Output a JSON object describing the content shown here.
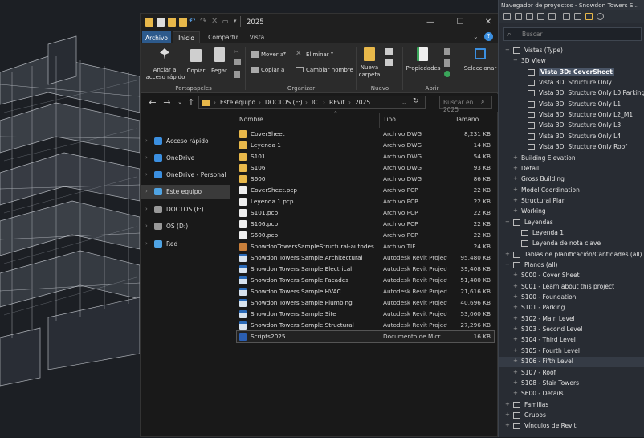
{
  "window": {
    "title": "2025",
    "minimize": "—",
    "maximize": "☐",
    "close": "✕"
  },
  "tabs": [
    "Archivo",
    "Inicio",
    "Compartir",
    "Vista"
  ],
  "ribbon": {
    "anclar": "Anclar al acceso rápido",
    "copiar": "Copiar",
    "pegar": "Pegar",
    "portapapeles": "Portapapeles",
    "mover": "Mover a",
    "copiar_a": "Copiar a",
    "eliminar": "Eliminar",
    "cambiar": "Cambiar nombre",
    "organizar": "Organizar",
    "nueva": "Nueva carpeta",
    "nuevo": "Nuevo",
    "propiedades": "Propiedades",
    "abrir": "Abrir",
    "seleccionar": "Seleccionar"
  },
  "address": {
    "crumbs": [
      "Este equipo",
      "DOCTOS (F:)",
      "IC",
      "REvit",
      "2025"
    ],
    "search_placeholder": "Buscar en 2025"
  },
  "nav": [
    {
      "label": "Acceso rápido",
      "icon": "star-icon",
      "color": "#3b8fe0"
    },
    {
      "label": "OneDrive",
      "icon": "cloud-icon",
      "color": "#3b8fe0"
    },
    {
      "label": "OneDrive - Personal",
      "icon": "cloud-icon",
      "color": "#3b8fe0"
    },
    {
      "label": "Este equipo",
      "icon": "pc-icon",
      "color": "#4fa3e3"
    },
    {
      "label": "DOCTOS (F:)",
      "icon": "drive-icon",
      "color": "#999999"
    },
    {
      "label": "OS (D:)",
      "icon": "drive-icon",
      "color": "#999999"
    },
    {
      "label": "Red",
      "icon": "network-icon",
      "color": "#4fa3e3"
    }
  ],
  "columns": {
    "name": "Nombre",
    "type": "Tipo",
    "size": "Tamaño"
  },
  "files": [
    {
      "name": "CoverSheet",
      "type": "Archivo DWG",
      "size": "8,231 KB",
      "icon": "folder-yellow"
    },
    {
      "name": "Leyenda 1",
      "type": "Archivo DWG",
      "size": "14 KB",
      "icon": "folder-yellow"
    },
    {
      "name": "S101",
      "type": "Archivo DWG",
      "size": "54 KB",
      "icon": "folder-yellow"
    },
    {
      "name": "S106",
      "type": "Archivo DWG",
      "size": "93 KB",
      "icon": "folder-yellow"
    },
    {
      "name": "S600",
      "type": "Archivo DWG",
      "size": "86 KB",
      "icon": "folder-yellow"
    },
    {
      "name": "CoverSheet.pcp",
      "type": "Archivo PCP",
      "size": "22 KB",
      "icon": "doc"
    },
    {
      "name": "Leyenda 1.pcp",
      "type": "Archivo PCP",
      "size": "22 KB",
      "icon": "doc"
    },
    {
      "name": "S101.pcp",
      "type": "Archivo PCP",
      "size": "22 KB",
      "icon": "doc"
    },
    {
      "name": "S106.pcp",
      "type": "Archivo PCP",
      "size": "22 KB",
      "icon": "doc"
    },
    {
      "name": "S600.pcp",
      "type": "Archivo PCP",
      "size": "22 KB",
      "icon": "doc"
    },
    {
      "name": "SnowdonTowersSampleStructural-autodes...",
      "type": "Archivo TIF",
      "size": "24 KB",
      "icon": "image"
    },
    {
      "name": "Snowdon Towers Sample Architectural",
      "type": "Autodesk Revit Project",
      "size": "95,480 KB",
      "icon": "revit"
    },
    {
      "name": "Snowdon Towers Sample Electrical",
      "type": "Autodesk Revit Project",
      "size": "39,408 KB",
      "icon": "revit"
    },
    {
      "name": "Snowdon Towers Sample Facades",
      "type": "Autodesk Revit Project",
      "size": "51,480 KB",
      "icon": "revit"
    },
    {
      "name": "Snowdon Towers Sample HVAC",
      "type": "Autodesk Revit Project",
      "size": "21,616 KB",
      "icon": "revit"
    },
    {
      "name": "Snowdon Towers Sample Plumbing",
      "type": "Autodesk Revit Project",
      "size": "40,696 KB",
      "icon": "revit"
    },
    {
      "name": "Snowdon Towers Sample Site",
      "type": "Autodesk Revit Project",
      "size": "53,060 KB",
      "icon": "revit"
    },
    {
      "name": "Snowdon Towers Sample Structural",
      "type": "Autodesk Revit Project",
      "size": "27,296 KB",
      "icon": "revit"
    },
    {
      "name": "Scripts2025",
      "type": "Documento de Micr...",
      "size": "16 KB",
      "icon": "word"
    }
  ],
  "project_browser": {
    "title": "Navegador de proyectos - Snowdon Towers S...",
    "search_placeholder": "Buscar",
    "tree": [
      {
        "label": "Vistas (Type)",
        "level": 0,
        "toggle": "−",
        "icon": "views"
      },
      {
        "label": "3D View",
        "level": 1,
        "toggle": "−"
      },
      {
        "label": "Vista 3D: CoverSheet",
        "level": 2,
        "toggle": "",
        "icon": "view",
        "selected": true
      },
      {
        "label": "Vista 3D: Structure Only",
        "level": 2,
        "toggle": "",
        "icon": "view"
      },
      {
        "label": "Vista 3D: Structure Only L0 Parking",
        "level": 2,
        "toggle": "",
        "icon": "view"
      },
      {
        "label": "Vista 3D: Structure Only L1",
        "level": 2,
        "toggle": "",
        "icon": "view"
      },
      {
        "label": "Vista 3D: Structure Only L2_M1",
        "level": 2,
        "toggle": "",
        "icon": "view"
      },
      {
        "label": "Vista 3D: Structure Only L3",
        "level": 2,
        "toggle": "",
        "icon": "view"
      },
      {
        "label": "Vista 3D: Structure Only L4",
        "level": 2,
        "toggle": "",
        "icon": "view"
      },
      {
        "label": "Vista 3D: Structure Only Roof",
        "level": 2,
        "toggle": "",
        "icon": "view"
      },
      {
        "label": "Building Elevation",
        "level": 1,
        "toggle": "+"
      },
      {
        "label": "Detail",
        "level": 1,
        "toggle": "+"
      },
      {
        "label": "Gross Building",
        "level": 1,
        "toggle": "+"
      },
      {
        "label": "Model Coordination",
        "level": 1,
        "toggle": "+"
      },
      {
        "label": "Structural Plan",
        "level": 1,
        "toggle": "+"
      },
      {
        "label": "Working",
        "level": 1,
        "toggle": "+"
      },
      {
        "label": "Leyendas",
        "level": 0,
        "toggle": "−",
        "icon": "legend"
      },
      {
        "label": "Leyenda 1",
        "level": 1,
        "toggle": "",
        "icon": "view"
      },
      {
        "label": "Leyenda de nota clave",
        "level": 1,
        "toggle": "",
        "icon": "view"
      },
      {
        "label": "Tablas de planificación/Cantidades (all)",
        "level": 0,
        "toggle": "+",
        "icon": "table"
      },
      {
        "label": "Planos (all)",
        "level": 0,
        "toggle": "−",
        "icon": "sheet"
      },
      {
        "label": "S000 - Cover Sheet",
        "level": 1,
        "toggle": "+"
      },
      {
        "label": "S001 - Learn about this project",
        "level": 1,
        "toggle": "+"
      },
      {
        "label": "S100 - Foundation",
        "level": 1,
        "toggle": "+"
      },
      {
        "label": "S101 - Parking",
        "level": 1,
        "toggle": "+"
      },
      {
        "label": "S102 - Main Level",
        "level": 1,
        "toggle": "+"
      },
      {
        "label": "S103 - Second Level",
        "level": 1,
        "toggle": "+"
      },
      {
        "label": "S104 - Third Level",
        "level": 1,
        "toggle": "+"
      },
      {
        "label": "S105 - Fourth Level",
        "level": 1,
        "toggle": "+"
      },
      {
        "label": "S106 - Fifth Level",
        "level": 1,
        "toggle": "+",
        "highlight": true
      },
      {
        "label": "S107 - Roof",
        "level": 1,
        "toggle": "+"
      },
      {
        "label": "S108 - Stair Towers",
        "level": 1,
        "toggle": "+"
      },
      {
        "label": "S600 - Details",
        "level": 1,
        "toggle": "+"
      },
      {
        "label": "Familias",
        "level": 0,
        "toggle": "+",
        "icon": "family"
      },
      {
        "label": "Grupos",
        "level": 0,
        "toggle": "+",
        "icon": "group"
      },
      {
        "label": "Vínculos de Revit",
        "level": 0,
        "toggle": "+",
        "icon": "link"
      }
    ]
  }
}
